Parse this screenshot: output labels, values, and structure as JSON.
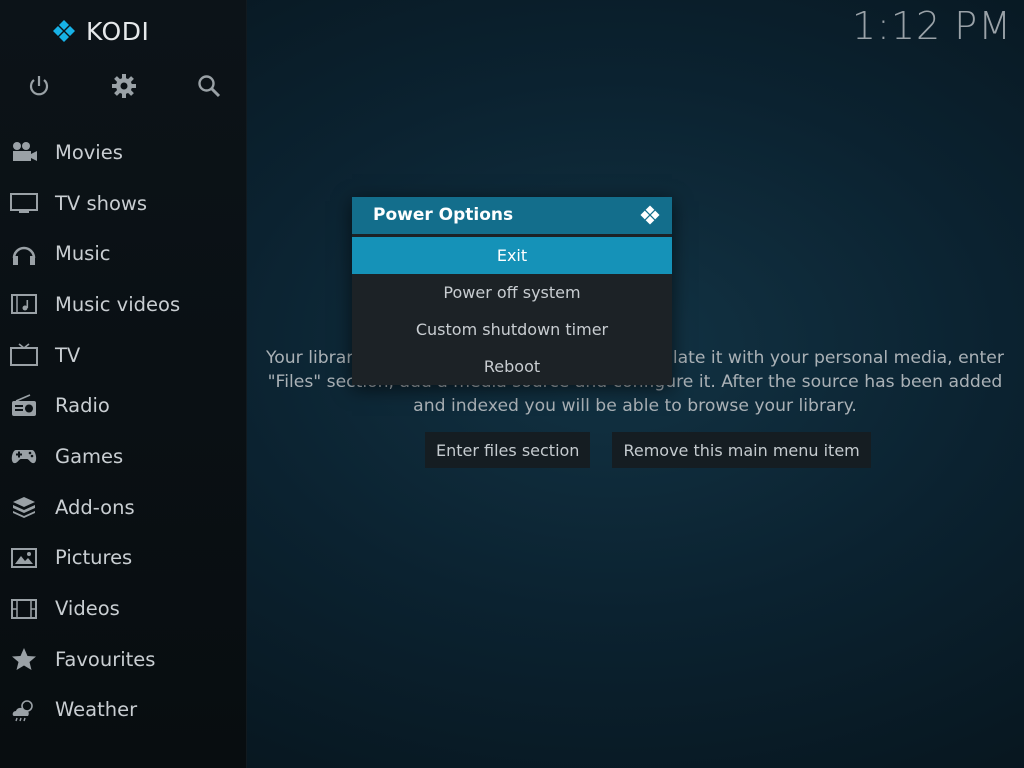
{
  "app": {
    "name": "KODI",
    "clock": "1:12 PM"
  },
  "top_icons": [
    {
      "name": "power-icon"
    },
    {
      "name": "gear-icon"
    },
    {
      "name": "search-icon"
    }
  ],
  "menu": [
    {
      "label": "Movies",
      "icon": "movie-camera-icon"
    },
    {
      "label": "TV shows",
      "icon": "monitor-icon"
    },
    {
      "label": "Music",
      "icon": "headphones-icon"
    },
    {
      "label": "Music videos",
      "icon": "film-strip-music-icon"
    },
    {
      "label": "TV",
      "icon": "tv-icon"
    },
    {
      "label": "Radio",
      "icon": "radio-icon"
    },
    {
      "label": "Games",
      "icon": "gamepad-icon"
    },
    {
      "label": "Add-ons",
      "icon": "addon-box-icon"
    },
    {
      "label": "Pictures",
      "icon": "picture-icon"
    },
    {
      "label": "Videos",
      "icon": "film-strip-icon"
    },
    {
      "label": "Favourites",
      "icon": "star-icon"
    },
    {
      "label": "Weather",
      "icon": "weather-cloud-icon"
    }
  ],
  "main": {
    "message_line1": "Your library is currently empty. In order to populate it with your personal media, enter",
    "message_line2": "\"Files\" section, add a media source and configure it. After the source has been added",
    "message_line3": "and indexed you will be able to browse your library.",
    "enter_files_label": "Enter files section",
    "remove_item_label": "Remove this main menu item"
  },
  "dialog": {
    "title": "Power Options",
    "options": [
      "Exit",
      "Power off system",
      "Custom shutdown timer",
      "Reboot"
    ],
    "selected_index": 0
  },
  "colors": {
    "accent": "#1592b8",
    "header": "#136e8c",
    "kodi_logo": "#17b2e7"
  }
}
